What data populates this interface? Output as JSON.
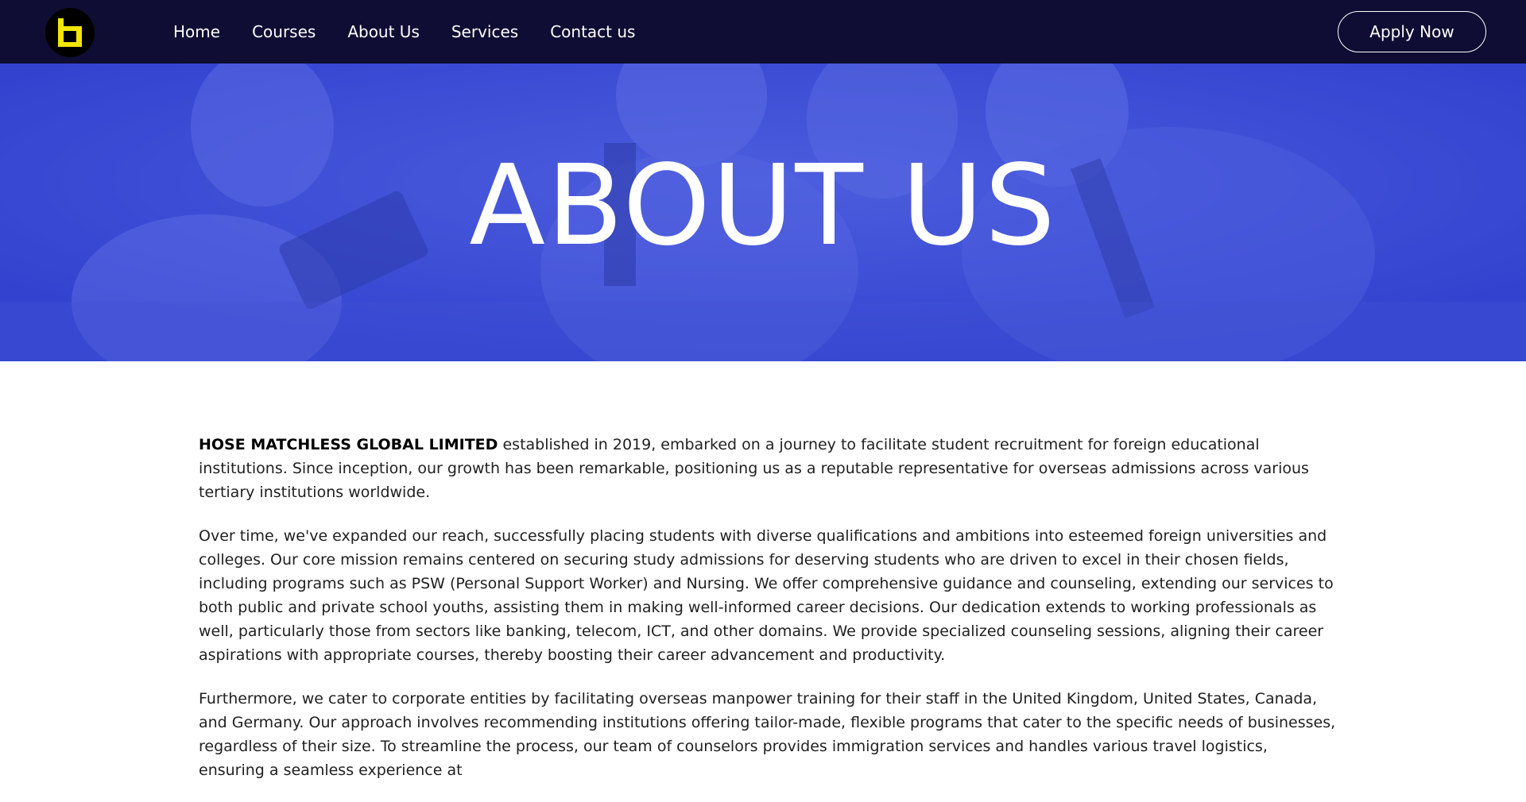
{
  "nav": {
    "logo_icon": "brand-logo",
    "links": [
      "Home",
      "Courses",
      "About Us",
      "Services",
      "Contact us"
    ],
    "apply_label": "Apply Now"
  },
  "hero": {
    "title": "ABOUT US"
  },
  "content": {
    "company_name": "HOSE MATCHLESS GLOBAL LIMITED",
    "p1_rest": " established in 2019, embarked on a journey to facilitate student recruitment for foreign educational institutions. Since inception, our growth has been remarkable, positioning us as a reputable representative for overseas admissions across various tertiary institutions worldwide.",
    "p2": "Over time, we've expanded our reach, successfully placing students with diverse qualifications and ambitions into esteemed foreign universities and colleges. Our core mission remains centered on securing study admissions for deserving students who are driven to excel in their chosen fields, including programs such as PSW (Personal Support Worker) and Nursing. We offer comprehensive guidance and counseling, extending our services to both public and private school youths, assisting them in making well-informed career decisions. Our dedication extends to working professionals as well, particularly those from sectors like banking, telecom, ICT, and other domains. We provide specialized counseling sessions, aligning their career aspirations with appropriate courses, thereby boosting their career advancement and productivity.",
    "p3": "Furthermore, we cater to corporate entities by facilitating overseas manpower training for their staff in the United Kingdom, United States, Canada, and Germany. Our approach involves recommending institutions offering tailor-made, flexible programs that cater to the specific needs of businesses, regardless of their size. To streamline the process, our team of counselors provides immigration services and handles various travel logistics, ensuring a seamless experience at"
  },
  "colors": {
    "navbar": "#0f0d33",
    "hero_blue": "#3b4ccf",
    "logo_yellow": "#f2e600"
  }
}
